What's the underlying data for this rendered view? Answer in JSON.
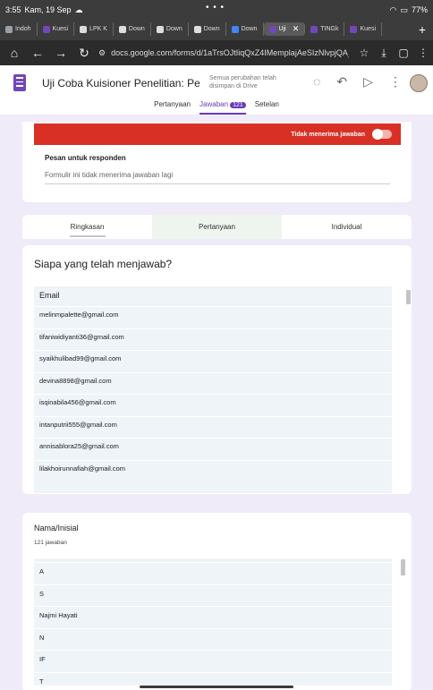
{
  "status": {
    "time": "3:55",
    "date": "Kam, 19 Sep",
    "dots": "• • •",
    "battery": "77%"
  },
  "browser_tabs": [
    {
      "label": "Indoh",
      "color": "#9aa0a6"
    },
    {
      "label": "Kuesi",
      "color": "#7248b9"
    },
    {
      "label": "LPK K",
      "color": "#dddddd"
    },
    {
      "label": "Down",
      "color": "#dddddd"
    },
    {
      "label": "Down",
      "color": "#dddddd"
    },
    {
      "label": "Down",
      "color": "#dddddd"
    },
    {
      "label": "Down",
      "color": "#4285f4"
    },
    {
      "label": "Uji",
      "color": "#7248b9",
      "active": true
    },
    {
      "label": "TINGk",
      "color": "#7248b9"
    },
    {
      "label": "Kuesi",
      "color": "#7248b9"
    }
  ],
  "address": {
    "url": "docs.google.com/forms/d/1aTrsOJtIiqQxZ4IMemplajAeSIzNlvpjQA_"
  },
  "form": {
    "title": "Uji Coba Kuisioner Penelitian: Pengaruh M",
    "saved": "Semua perubahan telah disimpan di Drive",
    "tabs": {
      "questions": "Pertanyaan",
      "responses": "Jawaban",
      "responses_count": "121",
      "settings": "Setelan"
    }
  },
  "accepting": {
    "label": "Tidak menerima jawaban",
    "message_label": "Pesan untuk responden",
    "message_value": "Formulir ini tidak menerima jawaban lagi"
  },
  "subtabs": {
    "summary": "Ringkasan",
    "question": "Pertanyaan",
    "individual": "Individual"
  },
  "who_answered": {
    "title": "Siapa yang telah menjawab?",
    "column": "Email",
    "emails": [
      "melinmpalette@gmail.com",
      "tifaniwidiyanti36@gmail.com",
      "syaikhulibad99@gmail.com",
      "devina8898@gmail.com",
      "isqinabila456@gmail.com",
      "intanputrii555@gmail.com",
      "annisablora25@gmail.com",
      "lilakhoirunnafiah@gmail.com"
    ]
  },
  "name_question": {
    "title": "Nama/Inisial",
    "count": "121 jawaban",
    "answers": [
      "A",
      "S",
      "Najmi Hayati",
      "N",
      "IF",
      "T"
    ]
  },
  "colors": {
    "accent": "#673ab7",
    "alert": "#d93025",
    "background": "#f0ebf8"
  }
}
